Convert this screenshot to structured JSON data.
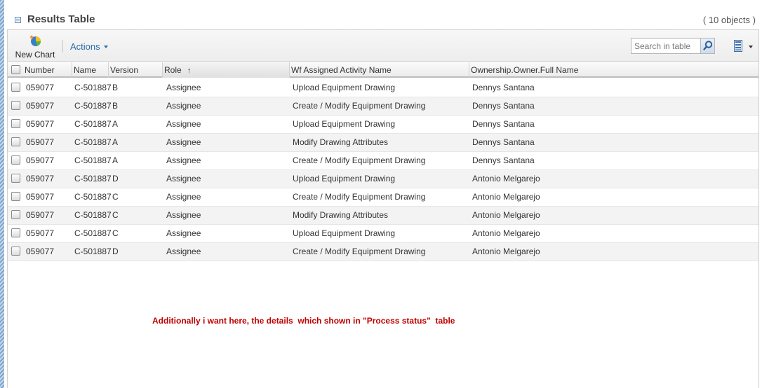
{
  "panel": {
    "title": "Results Table",
    "count": "( 10 objects )"
  },
  "toolbar": {
    "new_chart_label": "New Chart",
    "actions_label": "Actions",
    "search_placeholder": "Search in table"
  },
  "icons": {
    "collapse": "collapse-icon",
    "new_chart": "pie-chart-icon",
    "actions_dropdown": "chevron-down-icon",
    "search": "magnifier-icon",
    "column_settings": "columns-icon",
    "sort": "sort-ascending-icon"
  },
  "table": {
    "columns": [
      "Number",
      "Name",
      "Version",
      "Role",
      "Wf Assigned Activity Name",
      "Ownership.Owner.Full Name"
    ],
    "sorted_column": "Role",
    "sort_indicator": "↑",
    "rows": [
      {
        "number": "059077",
        "name": "C-501887",
        "version": "B",
        "role": "Assignee",
        "activity": "Upload Equipment Drawing",
        "owner": "Dennys Santana"
      },
      {
        "number": "059077",
        "name": "C-501887",
        "version": "B",
        "role": "Assignee",
        "activity": "Create / Modify Equipment Drawing",
        "owner": "Dennys Santana"
      },
      {
        "number": "059077",
        "name": "C-501887",
        "version": "A",
        "role": "Assignee",
        "activity": "Upload Equipment Drawing",
        "owner": "Dennys Santana"
      },
      {
        "number": "059077",
        "name": "C-501887",
        "version": "A",
        "role": "Assignee",
        "activity": "Modify Drawing Attributes",
        "owner": "Dennys Santana"
      },
      {
        "number": "059077",
        "name": "C-501887",
        "version": "A",
        "role": "Assignee",
        "activity": "Create / Modify Equipment Drawing",
        "owner": "Dennys Santana"
      },
      {
        "number": "059077",
        "name": "C-501887",
        "version": "D",
        "role": "Assignee",
        "activity": "Upload Equipment Drawing",
        "owner": "Antonio Melgarejo"
      },
      {
        "number": "059077",
        "name": "C-501887",
        "version": "C",
        "role": "Assignee",
        "activity": "Create / Modify Equipment Drawing",
        "owner": "Antonio Melgarejo"
      },
      {
        "number": "059077",
        "name": "C-501887",
        "version": "C",
        "role": "Assignee",
        "activity": "Modify Drawing Attributes",
        "owner": "Antonio Melgarejo"
      },
      {
        "number": "059077",
        "name": "C-501887",
        "version": "C",
        "role": "Assignee",
        "activity": "Upload Equipment Drawing",
        "owner": "Antonio Melgarejo"
      },
      {
        "number": "059077",
        "name": "C-501887",
        "version": "D",
        "role": "Assignee",
        "activity": "Create / Modify Equipment Drawing",
        "owner": "Antonio Melgarejo"
      }
    ]
  },
  "annotation": "Additionally i want here, the details  which shown in \"Process status\"  table",
  "colors": {
    "accent_blue": "#2d6aa8",
    "annotation_red": "#c00000",
    "row_alt": "#f3f3f3"
  }
}
